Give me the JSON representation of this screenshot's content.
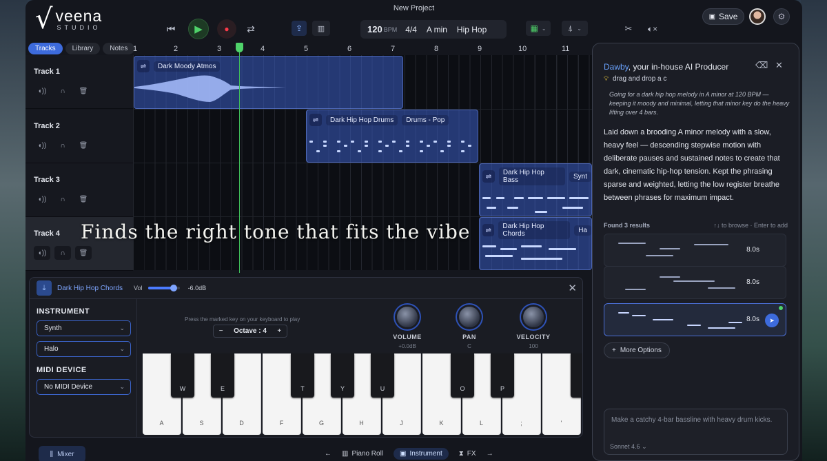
{
  "app": {
    "logo_mark": "√",
    "logo_name": "veena",
    "logo_sub": "STUDIO",
    "project_title": "New Project",
    "save_label": "Save"
  },
  "transport": {
    "bpm": "120",
    "bpm_unit": "BPM",
    "time_sig": "4/4",
    "key": "A min",
    "genre": "Hip Hop"
  },
  "tabs": [
    {
      "label": "Tracks"
    },
    {
      "label": "Library"
    },
    {
      "label": "Notes"
    }
  ],
  "ruler": [
    "1",
    "2",
    "3",
    "4",
    "5",
    "6",
    "7",
    "8",
    "9",
    "10",
    "11"
  ],
  "tracks": [
    {
      "name": "Track 1"
    },
    {
      "name": "Track 2"
    },
    {
      "name": "Track 3"
    },
    {
      "name": "Track 4"
    }
  ],
  "clips": {
    "c1": {
      "name": "Dark Moody Atmos"
    },
    "c2": {
      "name": "Dark Hip Hop Drums",
      "tag": "Drums - Pop"
    },
    "c3": {
      "name": "Dark Hip Hop Bass",
      "tag": "Synt"
    },
    "c4": {
      "name": "Dark Hip Hop Chords",
      "tag": "Ha"
    }
  },
  "caption": "Finds the right tone that fits the vibe",
  "instrument_panel": {
    "title": "Dark Hip Hop Chords",
    "vol_label": "Vol",
    "vol_db": "-6.0dB",
    "vol_level": 0.75,
    "instrument_label": "INSTRUMENT",
    "instrument": "Synth",
    "preset": "Halo",
    "midi_label": "MIDI DEVICE",
    "midi_device": "No MIDI Device",
    "hint": "Press the marked key on your keyboard to play",
    "octave": "Octave : 4",
    "knobs": [
      {
        "label": "VOLUME",
        "value": "+0.0dB"
      },
      {
        "label": "PAN",
        "value": "C"
      },
      {
        "label": "VELOCITY",
        "value": "100"
      }
    ],
    "white_keys": [
      "A",
      "S",
      "D",
      "F",
      "G",
      "H",
      "J",
      "K",
      "L",
      ";",
      "'"
    ],
    "black_keys": [
      "W",
      "E",
      "T",
      "Y",
      "U",
      "O",
      "P"
    ]
  },
  "bottom": {
    "mixer": "Mixer",
    "piano_roll": "Piano Roll",
    "instrument": "Instrument",
    "fx": "FX"
  },
  "ai": {
    "name": "Dawby",
    "subtitle": ", your in-house AI Producer",
    "tip": "drag and drop a c",
    "prompt_quote": "Going for a dark hip hop melody in A minor at 120 BPM — keeping it moody and minimal, letting that minor key do the heavy lifting over 4 bars.",
    "response": "Laid down a brooding A minor melody with a slow, heavy feel — descending stepwise motion with deliberate pauses and sustained notes to create that dark, cinematic hip-hop tension. Kept the phrasing sparse and weighted, letting the low register breathe between phrases for maximum impact.",
    "found": "Found 3 results",
    "browse": "↑↓ to browse · Enter to add",
    "results": [
      {
        "duration": "8.0s"
      },
      {
        "duration": "8.0s"
      },
      {
        "duration": "8.0s"
      }
    ],
    "more_options": "More Options",
    "input_placeholder": "Make a catchy 4-bar bassline with heavy drum kicks.",
    "model": "Sonnet 4.6"
  }
}
